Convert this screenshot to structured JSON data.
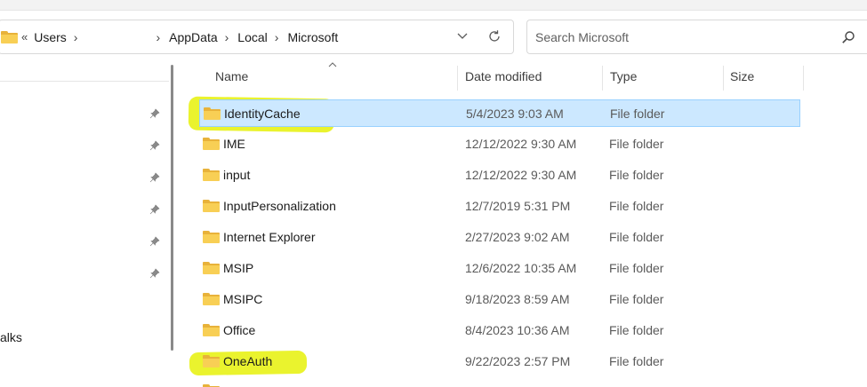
{
  "address": {
    "crumbs": [
      {
        "label": "Users"
      },
      {
        "label": "AppData"
      },
      {
        "label": "Local"
      },
      {
        "label": "Microsoft"
      }
    ],
    "overflow": "«",
    "chevron": "›"
  },
  "search": {
    "placeholder": "Search Microsoft"
  },
  "columns": {
    "name": "Name",
    "date": "Date modified",
    "type": "Type",
    "size": "Size"
  },
  "sort": {
    "column": "Name",
    "direction": "ascending"
  },
  "nav": {
    "partial_label": "alks"
  },
  "files": [
    {
      "name": "IdentityCache",
      "date": "5/4/2023 9:03 AM",
      "type": "File folder",
      "size": "",
      "selected": true,
      "highlighted": true
    },
    {
      "name": "IME",
      "date": "12/12/2022 9:30 AM",
      "type": "File folder",
      "size": ""
    },
    {
      "name": "input",
      "date": "12/12/2022 9:30 AM",
      "type": "File folder",
      "size": ""
    },
    {
      "name": "InputPersonalization",
      "date": "12/7/2019 5:31 PM",
      "type": "File folder",
      "size": ""
    },
    {
      "name": "Internet Explorer",
      "date": "2/27/2023 9:02 AM",
      "type": "File folder",
      "size": ""
    },
    {
      "name": "MSIP",
      "date": "12/6/2022 10:35 AM",
      "type": "File folder",
      "size": ""
    },
    {
      "name": "MSIPC",
      "date": "9/18/2023 8:59 AM",
      "type": "File folder",
      "size": ""
    },
    {
      "name": "Office",
      "date": "8/4/2023 10:36 AM",
      "type": "File folder",
      "size": ""
    },
    {
      "name": "OneAuth",
      "date": "9/22/2023 2:57 PM",
      "type": "File folder",
      "size": "",
      "highlighted": true
    }
  ],
  "colors": {
    "selection_bg": "#cce8ff",
    "selection_border": "#99d1ff",
    "highlighter": "#e8f21c",
    "folder": "#f8cf55"
  },
  "icons": [
    "folder-icon",
    "search-icon",
    "refresh-icon",
    "chevron-down-icon",
    "pin-icon"
  ]
}
